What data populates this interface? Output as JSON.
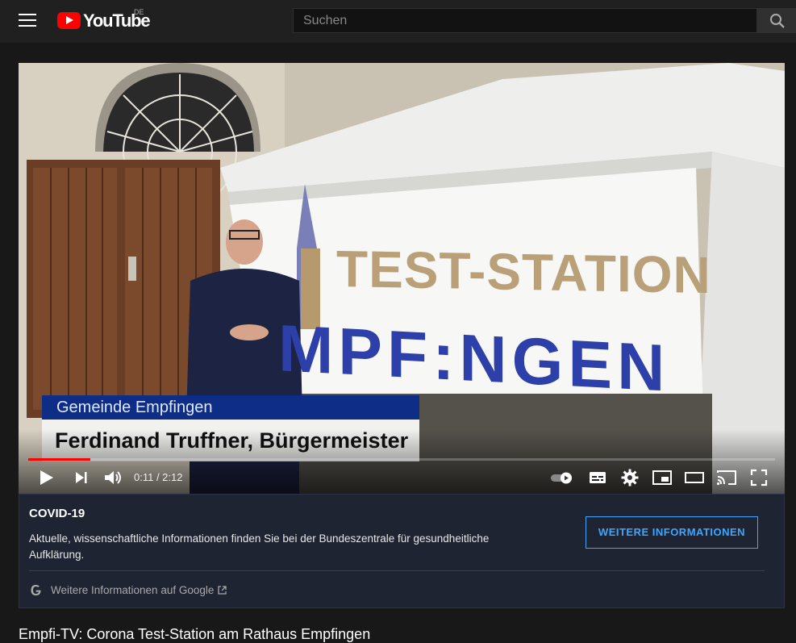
{
  "header": {
    "logo_text": "YouTube",
    "country_code": "DE",
    "search_placeholder": "Suchen"
  },
  "player": {
    "caption_line1": "Gemeinde Empfingen",
    "caption_line2": "Ferdinand Truffner, Bürgermeister",
    "banner_line1": "TEST-STATION",
    "banner_line2": "MPF:NGEN",
    "time_display": "0:11 / 2:12",
    "progress": 0.083,
    "colors": {
      "progress": "#ff0000",
      "caption_blue": "#0d2d86"
    }
  },
  "info_panel": {
    "title": "COVID-19",
    "text": "Aktuelle, wissenschaftliche Informationen finden Sie bei der Bundeszentrale für gesundheitliche Aufklärung.",
    "button_label": "WEITERE INFORMATIONEN",
    "link_text": "Weitere Informationen auf Google",
    "accent": "#3ea6ff"
  },
  "video": {
    "title": "Empfi-TV: Corona Test-Station am Rathaus Empfingen"
  },
  "icons": [
    "menu-icon",
    "youtube-logo-icon",
    "search-icon",
    "play-icon",
    "next-icon",
    "volume-icon",
    "autoplay-toggle-icon",
    "subtitles-icon",
    "settings-icon",
    "miniplayer-icon",
    "theater-mode-icon",
    "cast-icon",
    "fullscreen-icon",
    "google-g-icon",
    "external-link-icon"
  ]
}
